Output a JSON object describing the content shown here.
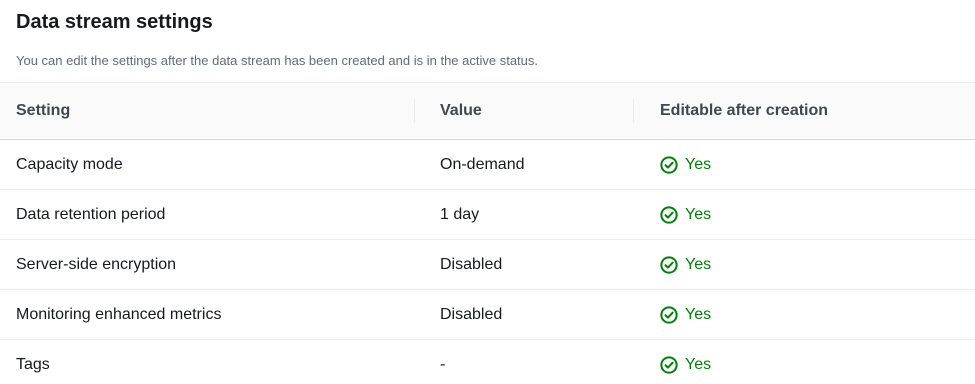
{
  "panel": {
    "title": "Data stream settings",
    "description": "You can edit the settings after the data stream has been created and is in the active status."
  },
  "table": {
    "columns": [
      "Setting",
      "Value",
      "Editable after creation"
    ],
    "rows": [
      {
        "setting": "Capacity mode",
        "value": "On-demand",
        "editable": "Yes"
      },
      {
        "setting": "Data retention period",
        "value": "1 day",
        "editable": "Yes"
      },
      {
        "setting": "Server-side encryption",
        "value": "Disabled",
        "editable": "Yes"
      },
      {
        "setting": "Monitoring enhanced metrics",
        "value": "Disabled",
        "editable": "Yes"
      },
      {
        "setting": "Tags",
        "value": "-",
        "editable": "Yes"
      }
    ]
  },
  "colors": {
    "success": "#037f0c",
    "text": "#16191f",
    "muted": "#5f6b7a"
  },
  "icons": {
    "editable_status": "check-circle-icon"
  }
}
